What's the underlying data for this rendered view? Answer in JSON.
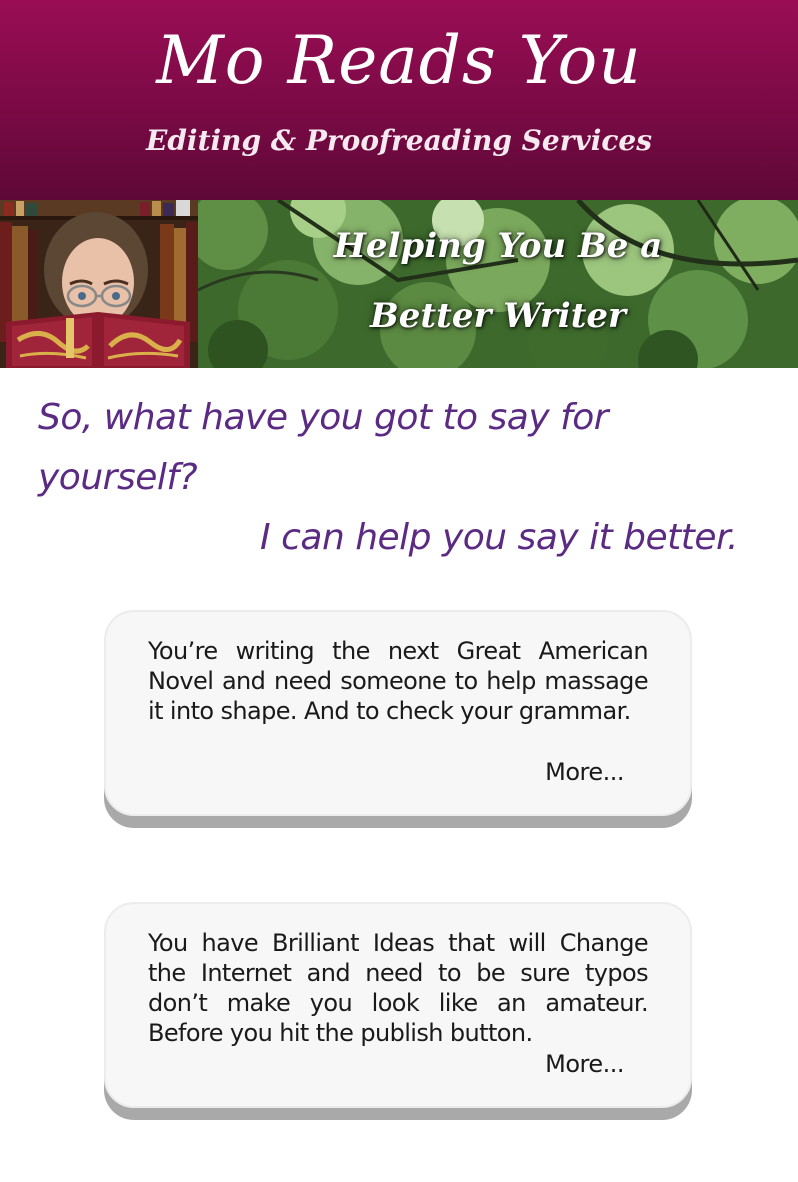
{
  "header": {
    "title": "Mo Reads You",
    "subtitle": "Editing & Proofreading Services"
  },
  "banner": {
    "tagline_line1": "Helping You Be a",
    "tagline_line2": "Better Writer"
  },
  "intro": {
    "question": "So, what have you got to say for yourself?",
    "answer": "I can help you say it better."
  },
  "cards": [
    {
      "text": "You’re writing the next Great American Novel and need someone to help massage it into shape. And to check your grammar.",
      "more_label": "More..."
    },
    {
      "text": "You have Brilliant Ideas that will Change the Internet and need to be sure typos don’t make you look like an amateur. Before you hit the publish button.",
      "more_label": "More..."
    }
  ],
  "colors": {
    "header_primary": "#8a0c4e",
    "accent_text": "#5b2b84",
    "card_background": "#f7f7f7",
    "card_shadow": "#a9a9a9"
  }
}
